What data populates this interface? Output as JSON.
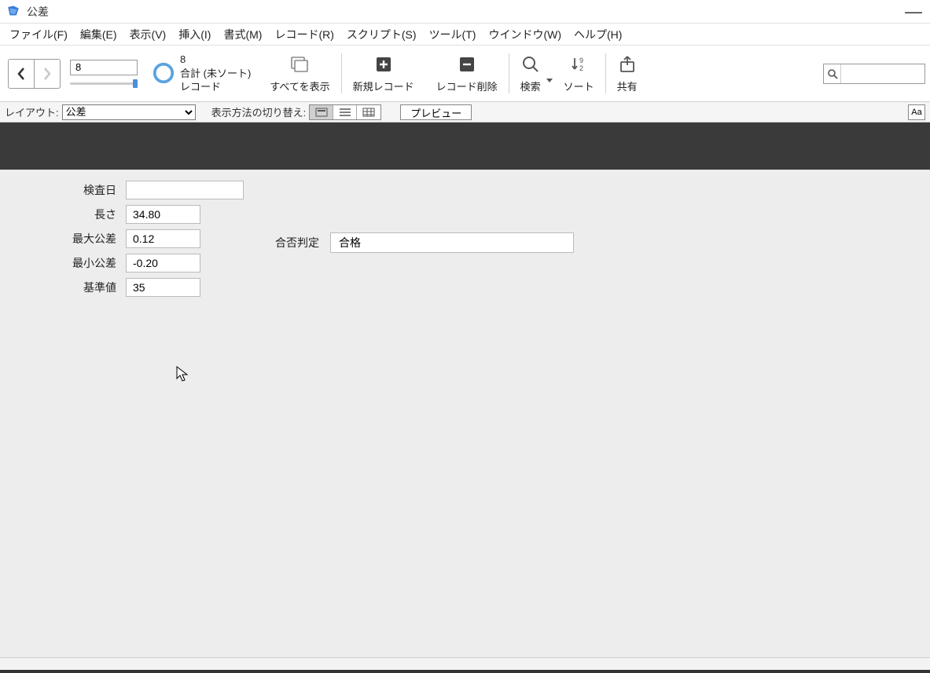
{
  "window": {
    "title": "公差"
  },
  "menu": {
    "file": "ファイル(F)",
    "edit": "編集(E)",
    "view": "表示(V)",
    "insert": "挿入(I)",
    "format": "書式(M)",
    "records": "レコード(R)",
    "scripts": "スクリプト(S)",
    "tools": "ツール(T)",
    "window": "ウインドウ(W)",
    "help": "ヘルプ(H)"
  },
  "toolbar": {
    "record_number": "8",
    "total_count": "8",
    "total_label": "合計 (未ソート)",
    "record_label": "レコード",
    "show_all": "すべてを表示",
    "new_record": "新規レコード",
    "delete_record": "レコード削除",
    "search": "検索",
    "sort": "ソート",
    "share": "共有"
  },
  "layoutbar": {
    "layout_label": "レイアウト:",
    "layout_value": "公差",
    "viewswitch_label": "表示方法の切り替え:",
    "preview": "プレビュー",
    "aa": "Aa"
  },
  "form": {
    "labels": {
      "inspection_date": "検査日",
      "length": "長さ",
      "max_tolerance": "最大公差",
      "min_tolerance": "最小公差",
      "reference": "基準値",
      "judgement": "合否判定"
    },
    "values": {
      "inspection_date": "",
      "length": "34.80",
      "max_tolerance": "0.12",
      "min_tolerance": "-0.20",
      "reference": "35",
      "judgement": "合格"
    }
  }
}
